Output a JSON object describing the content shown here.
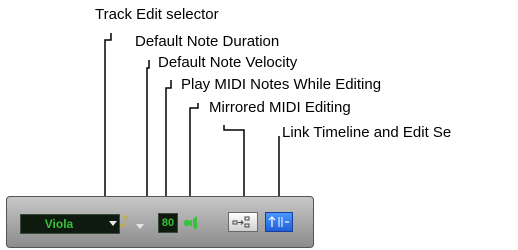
{
  "callouts": {
    "track_edit_selector": "Track Edit selector",
    "default_note_duration": "Default Note Duration",
    "default_note_velocity": "Default Note Velocity",
    "play_midi_notes": "Play MIDI Notes While Editing",
    "mirrored_midi_editing": "Mirrored MIDI Editing",
    "link_timeline": "Link Timeline and Edit Se"
  },
  "toolbar": {
    "track_name": "Viola",
    "note_duration_icon": "eighth-note-icon",
    "velocity_value": "80",
    "play_midi_icon": "speaker-icon",
    "mirrored_editing_icon": "mirrored-midi-icon",
    "link_timeline_icon": "link-timeline-edit-icon"
  },
  "colors": {
    "display_text": "#36c23a",
    "display_background": "#0d1a0d",
    "note_icon": "#c9b02a",
    "link_active": "#2f7bf0",
    "toolbar_panel": "#a9a9a9"
  }
}
